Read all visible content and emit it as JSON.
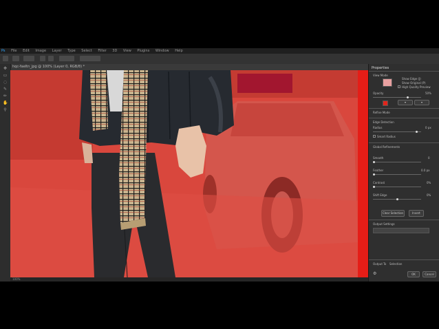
{
  "menu": [
    "File",
    "Edit",
    "Image",
    "Layer",
    "Type",
    "Select",
    "Filter",
    "3D",
    "View",
    "Plugins",
    "Window",
    "Help"
  ],
  "doc_tab": "hqc-faeltn_jpg @ 100% (Layer 0, RGB/8) *",
  "toolbar_icons": [
    "move-icon",
    "marquee-icon",
    "lasso-icon",
    "quick-select-icon",
    "crop-icon",
    "eyedropper-icon",
    "brush-icon",
    "stamp-icon",
    "eraser-icon",
    "gradient-icon",
    "pen-icon",
    "type-icon",
    "hand-icon",
    "zoom-icon"
  ],
  "status": "100%",
  "properties": {
    "title": "Properties",
    "view_mode_label": "View Mode",
    "show_edge": "Show Edge (J)",
    "show_original": "Show Original (P)",
    "high_quality_preview": "High Quality Preview",
    "transparency": "Opacity",
    "transparency_value": "50%",
    "overlay_color": "#e1251b",
    "refine_mode": "Refine Mode",
    "edge_detection": "Edge Detection",
    "radius": "Radius",
    "radius_value": "0 px",
    "smart_radius": "Smart Radius",
    "global_refinements": "Global Refinements",
    "smooth": "Smooth",
    "smooth_value": "0",
    "feather": "Feather",
    "feather_value": "0.0 px",
    "contrast": "Contrast",
    "contrast_value": "0%",
    "shift_edge": "Shift Edge",
    "shift_edge_value": "0%",
    "clear_selection": "Clear Selection",
    "invert": "Invert",
    "output_settings": "Output Settings",
    "output_to": "Output To",
    "output_value": "Selection",
    "ok": "OK",
    "cancel": "Cancel"
  }
}
